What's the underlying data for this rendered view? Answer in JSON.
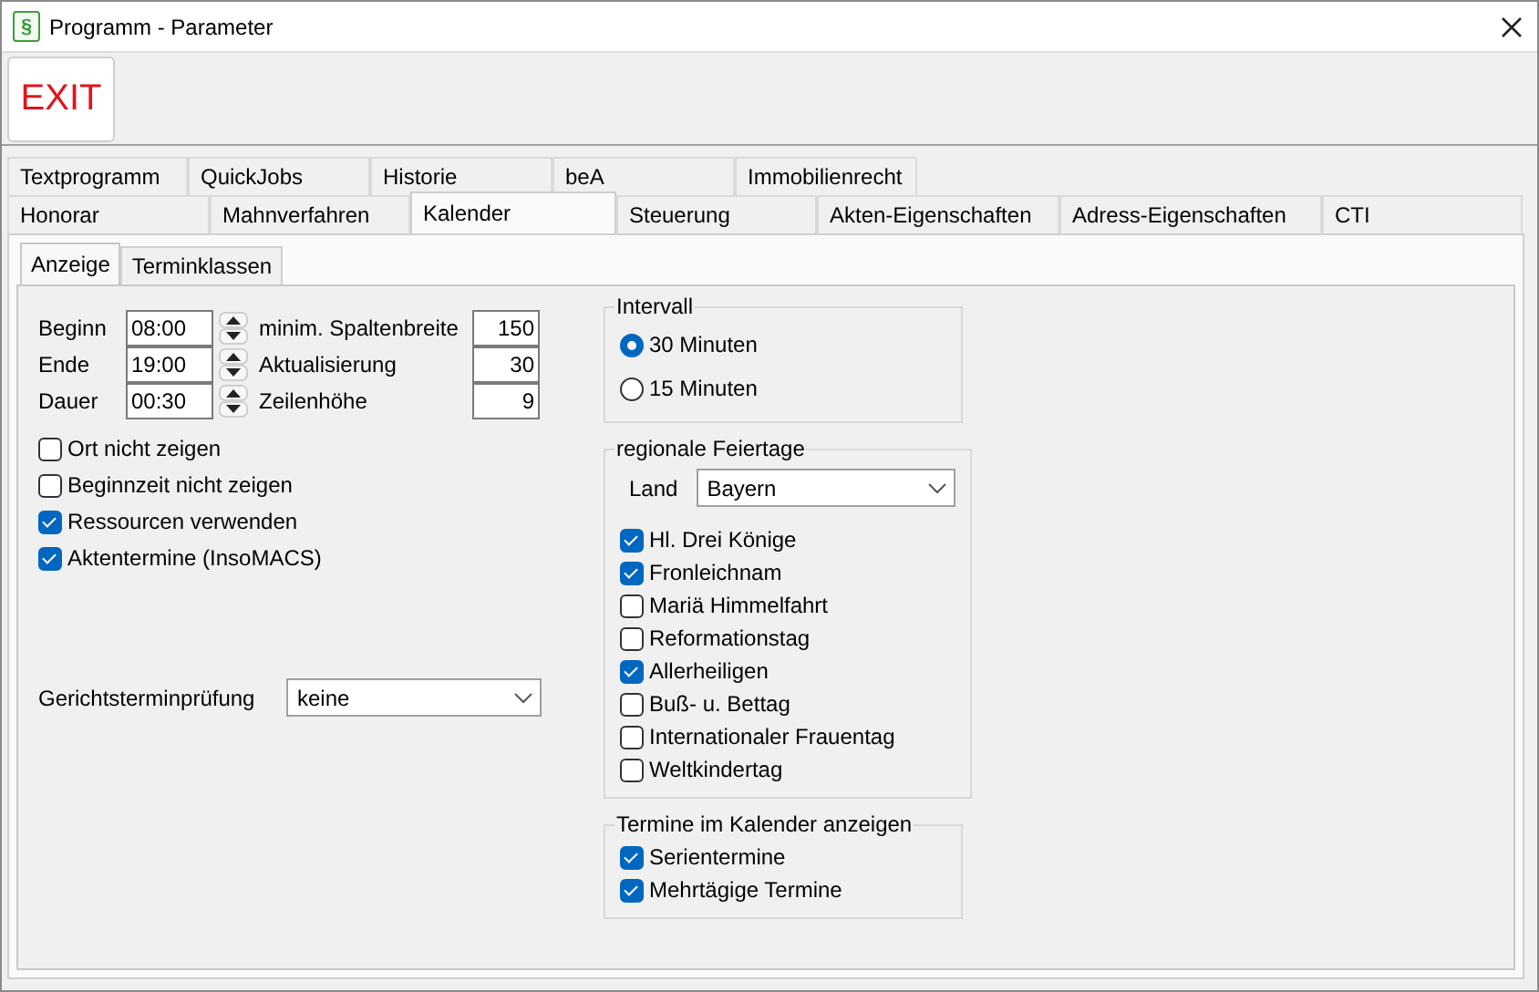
{
  "window": {
    "title": "Programm - Parameter",
    "icon_glyph": "§"
  },
  "toolbar": {
    "exit_button": "EXIT"
  },
  "tab_rows": [
    [
      {
        "label": "Textprogramm",
        "selected": false
      },
      {
        "label": "QuickJobs",
        "selected": false
      },
      {
        "label": "Historie",
        "selected": false
      },
      {
        "label": "beA",
        "selected": false
      },
      {
        "label": "Immobilienrecht",
        "selected": false
      }
    ],
    [
      {
        "label": "Honorar",
        "selected": false
      },
      {
        "label": "Mahnverfahren",
        "selected": false
      },
      {
        "label": "Kalender",
        "selected": true
      },
      {
        "label": "Steuerung",
        "selected": false
      },
      {
        "label": "Akten-Eigenschaften",
        "selected": false
      },
      {
        "label": "Adress-Eigenschaften",
        "selected": false
      },
      {
        "label": "CTI",
        "selected": false
      }
    ]
  ],
  "subtabs": [
    {
      "label": "Anzeige",
      "selected": true
    },
    {
      "label": "Terminklassen",
      "selected": false
    }
  ],
  "time_fields": [
    {
      "label": "Beginn",
      "value": "08:00"
    },
    {
      "label": "Ende",
      "value": "19:00"
    },
    {
      "label": "Dauer",
      "value": "00:30"
    }
  ],
  "number_fields": [
    {
      "label": "minim. Spaltenbreite",
      "value": "150"
    },
    {
      "label": "Aktualisierung",
      "value": "30"
    },
    {
      "label": "Zeilenhöhe",
      "value": "9"
    }
  ],
  "options": [
    {
      "label": "Ort nicht zeigen",
      "checked": false
    },
    {
      "label": "Beginnzeit nicht zeigen",
      "checked": false
    },
    {
      "label": "Ressourcen verwenden",
      "checked": true
    },
    {
      "label": "Aktentermine (InsoMACS)",
      "checked": true
    }
  ],
  "court_check": {
    "label": "Gerichtsterminprüfung",
    "value": "keine"
  },
  "interval": {
    "title": "Intervall",
    "options": [
      {
        "label": "30 Minuten",
        "selected": true
      },
      {
        "label": "15 Minuten",
        "selected": false
      }
    ]
  },
  "holidays": {
    "title": "regionale Feiertage",
    "land_label": "Land",
    "land_value": "Bayern",
    "items": [
      {
        "label": "Hl. Drei Könige",
        "checked": true
      },
      {
        "label": "Fronleichnam",
        "checked": true
      },
      {
        "label": "Mariä Himmelfahrt",
        "checked": false
      },
      {
        "label": "Reformationstag",
        "checked": false
      },
      {
        "label": "Allerheiligen",
        "checked": true
      },
      {
        "label": "Buß- u. Bettag",
        "checked": false
      },
      {
        "label": "Internationaler Frauentag",
        "checked": false
      },
      {
        "label": "Weltkindertag",
        "checked": false
      }
    ]
  },
  "calendar_display": {
    "title": "Termine im Kalender anzeigen",
    "items": [
      {
        "label": "Serientermine",
        "checked": true
      },
      {
        "label": "Mehrtägige Termine",
        "checked": true
      }
    ]
  }
}
